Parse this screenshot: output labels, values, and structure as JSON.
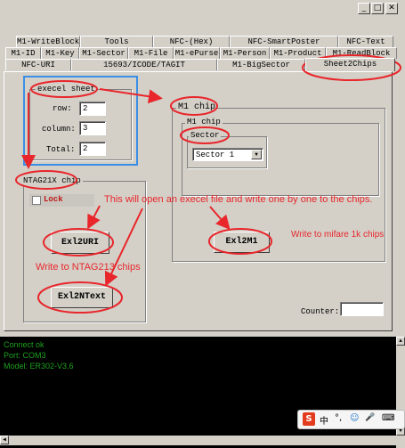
{
  "window_controls": {
    "minimize": "_",
    "maximize": "□",
    "close": "✕"
  },
  "tabs": {
    "row1": [
      "M1-WriteBlock",
      "Tools",
      "NFC-(Hex)",
      "NFC-SmartPoster",
      "NFC-Text"
    ],
    "row2": [
      "M1-ID",
      "M1-Key",
      "M1-Sector",
      "M1-File",
      "M1-ePurse",
      "M1-Person",
      "M1-Product",
      "M1-ReadBlock"
    ],
    "row3": [
      "NFC-URI",
      "15693/ICODE/TAGIT",
      "M1-BigSector",
      "Sheet2Chips"
    ],
    "active": "Sheet2Chips"
  },
  "excel_sheet": {
    "legend": "execel sheet",
    "row_label": "row:",
    "row_value": "2",
    "column_label": "column:",
    "column_value": "3",
    "total_label": "Total:",
    "total_value": "2"
  },
  "m1_chip": {
    "outer_legend": "M1 chip",
    "inner_legend": "M1 chip",
    "sector_legend": "Sector",
    "sector_selected": "Sector 1",
    "button_label": "Exl2M1"
  },
  "ntag_chip": {
    "legend": "NTAG21X chip",
    "lock_label": "Lock",
    "uri_button": "Exl2URI",
    "ntext_button": "Exl2NText"
  },
  "annotations": {
    "main": "This will open an execel file and write one by one to the chips.",
    "mifare": "Write to mifare 1k chips",
    "ntag": "Write to NTAG213 chips"
  },
  "counter": {
    "label": "Counter:",
    "value": ""
  },
  "console_lines": [
    "Connect ok",
    "Port: COM3",
    "Model: ER302-V3.6"
  ],
  "tray": {
    "ime_logo": "S",
    "lang": "中",
    "punct": "°,",
    "emoji": "☺",
    "mic": "🎤",
    "keyboard": "⌨"
  },
  "colors": {
    "annotation_red": "#e8262b",
    "highlight_blue": "#3a8ee6",
    "console_green": "#1fa01f"
  }
}
